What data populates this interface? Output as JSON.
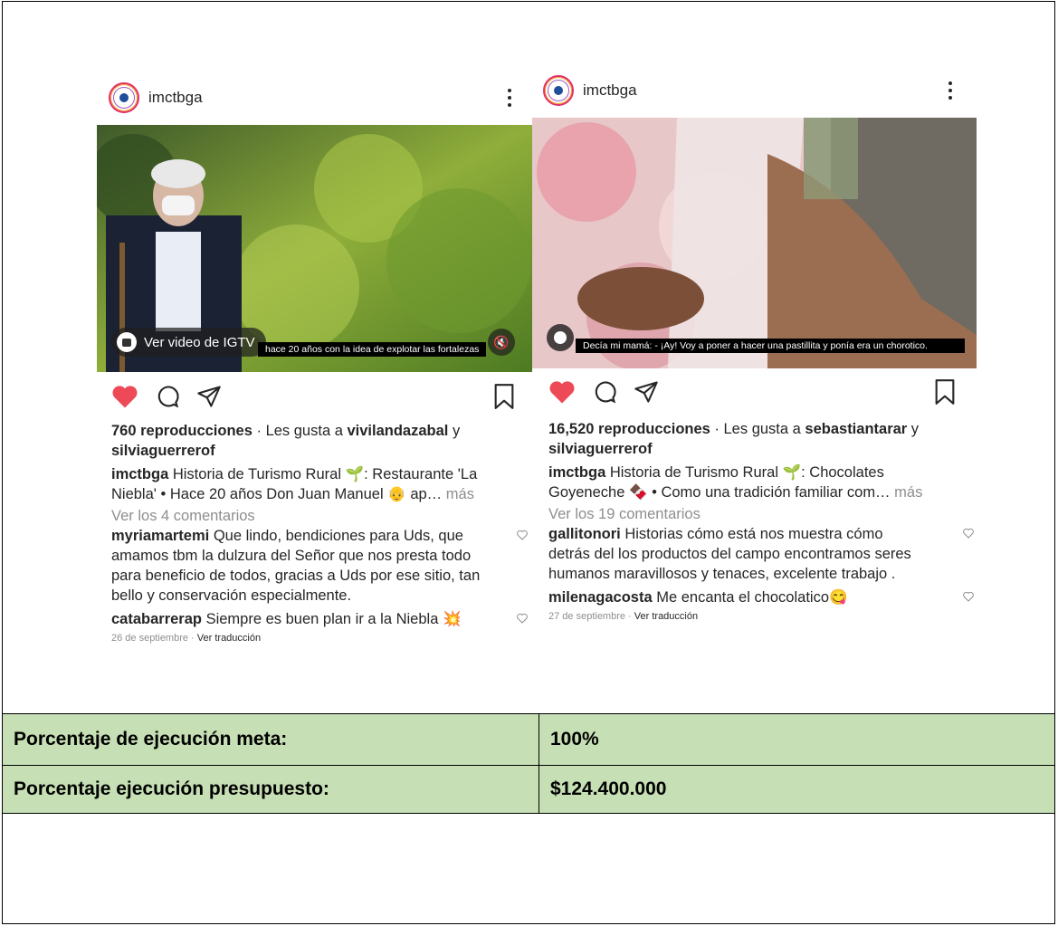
{
  "posts": [
    {
      "username": "imctbga",
      "igtv_label": "Ver video de IGTV",
      "subtitle": "hace 20 años con la idea de explotar las fortalezas",
      "views": "760 reproducciones",
      "likes_prefix": " · Les gusta a ",
      "liker1": "vivilandazabal",
      "likes_join": " y",
      "liker2": "silviaguerrerof",
      "caption_user": "imctbga",
      "caption_line1": " Historia de Turismo Rural 🌱: Restaurante 'La",
      "caption_line2": "Niebla' • Hace 20 años Don Juan Manuel 👴 ap…",
      "more": " más",
      "view_comments": "Ver los 4 comentarios",
      "comments": [
        {
          "user": "myriamartemi",
          "text": " Que lindo, bendiciones para Uds, que amamos tbm la dulzura del Señor que nos presta todo para beneficio de todos, gracias  a Uds por ese sitio, tan bello y conservación especialmente."
        },
        {
          "user": "catabarrerap",
          "text": " Siempre es buen plan ir a la Niebla 💥"
        }
      ],
      "date": "26 de septiembre",
      "translate": "Ver traducción"
    },
    {
      "username": "imctbga",
      "subtitle": "Decía mi mamá: - ¡Ay! Voy a poner a hacer una pastillita y ponía era un chorotico.",
      "views": "16,520 reproducciones",
      "likes_prefix": " · Les gusta a ",
      "liker1": "sebastiantarar",
      "likes_join": " y",
      "liker2": "silviaguerrerof",
      "caption_user": "imctbga",
      "caption_line1": " Historia de Turismo Rural 🌱: Chocolates",
      "caption_line2": "Goyeneche 🍫 • Como una tradición familiar com…",
      "more": " más",
      "view_comments": "Ver los 19 comentarios",
      "comments": [
        {
          "user": "gallitonori",
          "text": " Historias cómo está  nos muestra cómo detrás del los productos del campo encontramos seres humanos maravillosos y tenaces, excelente trabajo ."
        },
        {
          "user": "milenagacosta",
          "text": " Me encanta el chocolatico😋"
        }
      ],
      "date": "27 de septiembre",
      "translate": "Ver traducción"
    }
  ],
  "table": [
    {
      "label": "Porcentaje de ejecución meta:",
      "value": "100%"
    },
    {
      "label": "Porcentaje ejecución presupuesto:",
      "value": "$124.400.000"
    }
  ],
  "colors": {
    "heart": "#ed4956",
    "table_bg": "#c6dfb4",
    "muted": "#8e8e8e"
  }
}
